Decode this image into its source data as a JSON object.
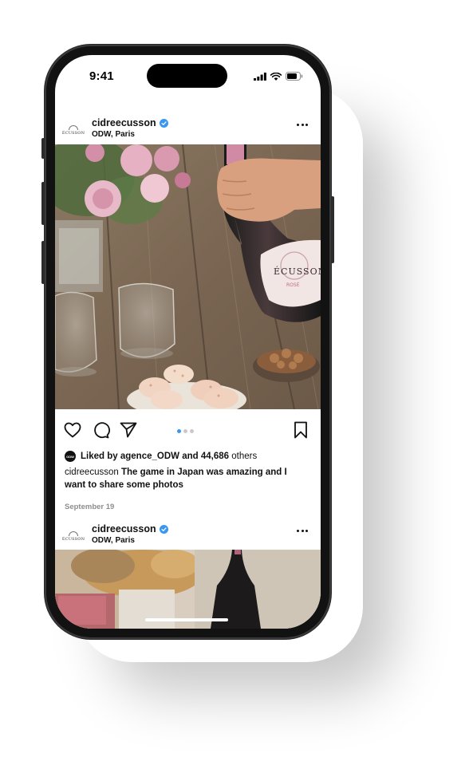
{
  "status_bar": {
    "time": "9:41"
  },
  "posts": [
    {
      "username": "cidreecusson",
      "location": "ODW, Paris",
      "brand_logo_text": "ÉCUSSON",
      "verified": true,
      "photo_description": "rosé cider bottle, glasses, macarons and flowers on a wooden table",
      "carousel_dots": 3,
      "carousel_active": 1
    },
    {
      "username": "cidreecusson",
      "location": "ODW, Paris",
      "brand_logo_text": "ÉCUSSON",
      "verified": true
    }
  ],
  "likes": {
    "avatar_text": "ODW",
    "prefix": "Liked by",
    "user": "agence_ODW",
    "joiner": "and",
    "count": "44,686",
    "suffix": "others"
  },
  "caption": {
    "username": "cidreecusson",
    "text": "The game in Japan was amazing and I want to share some photos"
  },
  "date": "September 19",
  "bottle_label": {
    "brand": "ÉCUSSON",
    "variant": "ROSÉ"
  },
  "icons": [
    "heart-icon",
    "comment-icon",
    "share-icon",
    "bookmark-icon",
    "more-icon",
    "verified-icon",
    "signal-icon",
    "wifi-icon",
    "battery-icon"
  ],
  "colors": {
    "verified": "#3897f0",
    "active_dot": "#3897f0",
    "frame": "#121212"
  }
}
